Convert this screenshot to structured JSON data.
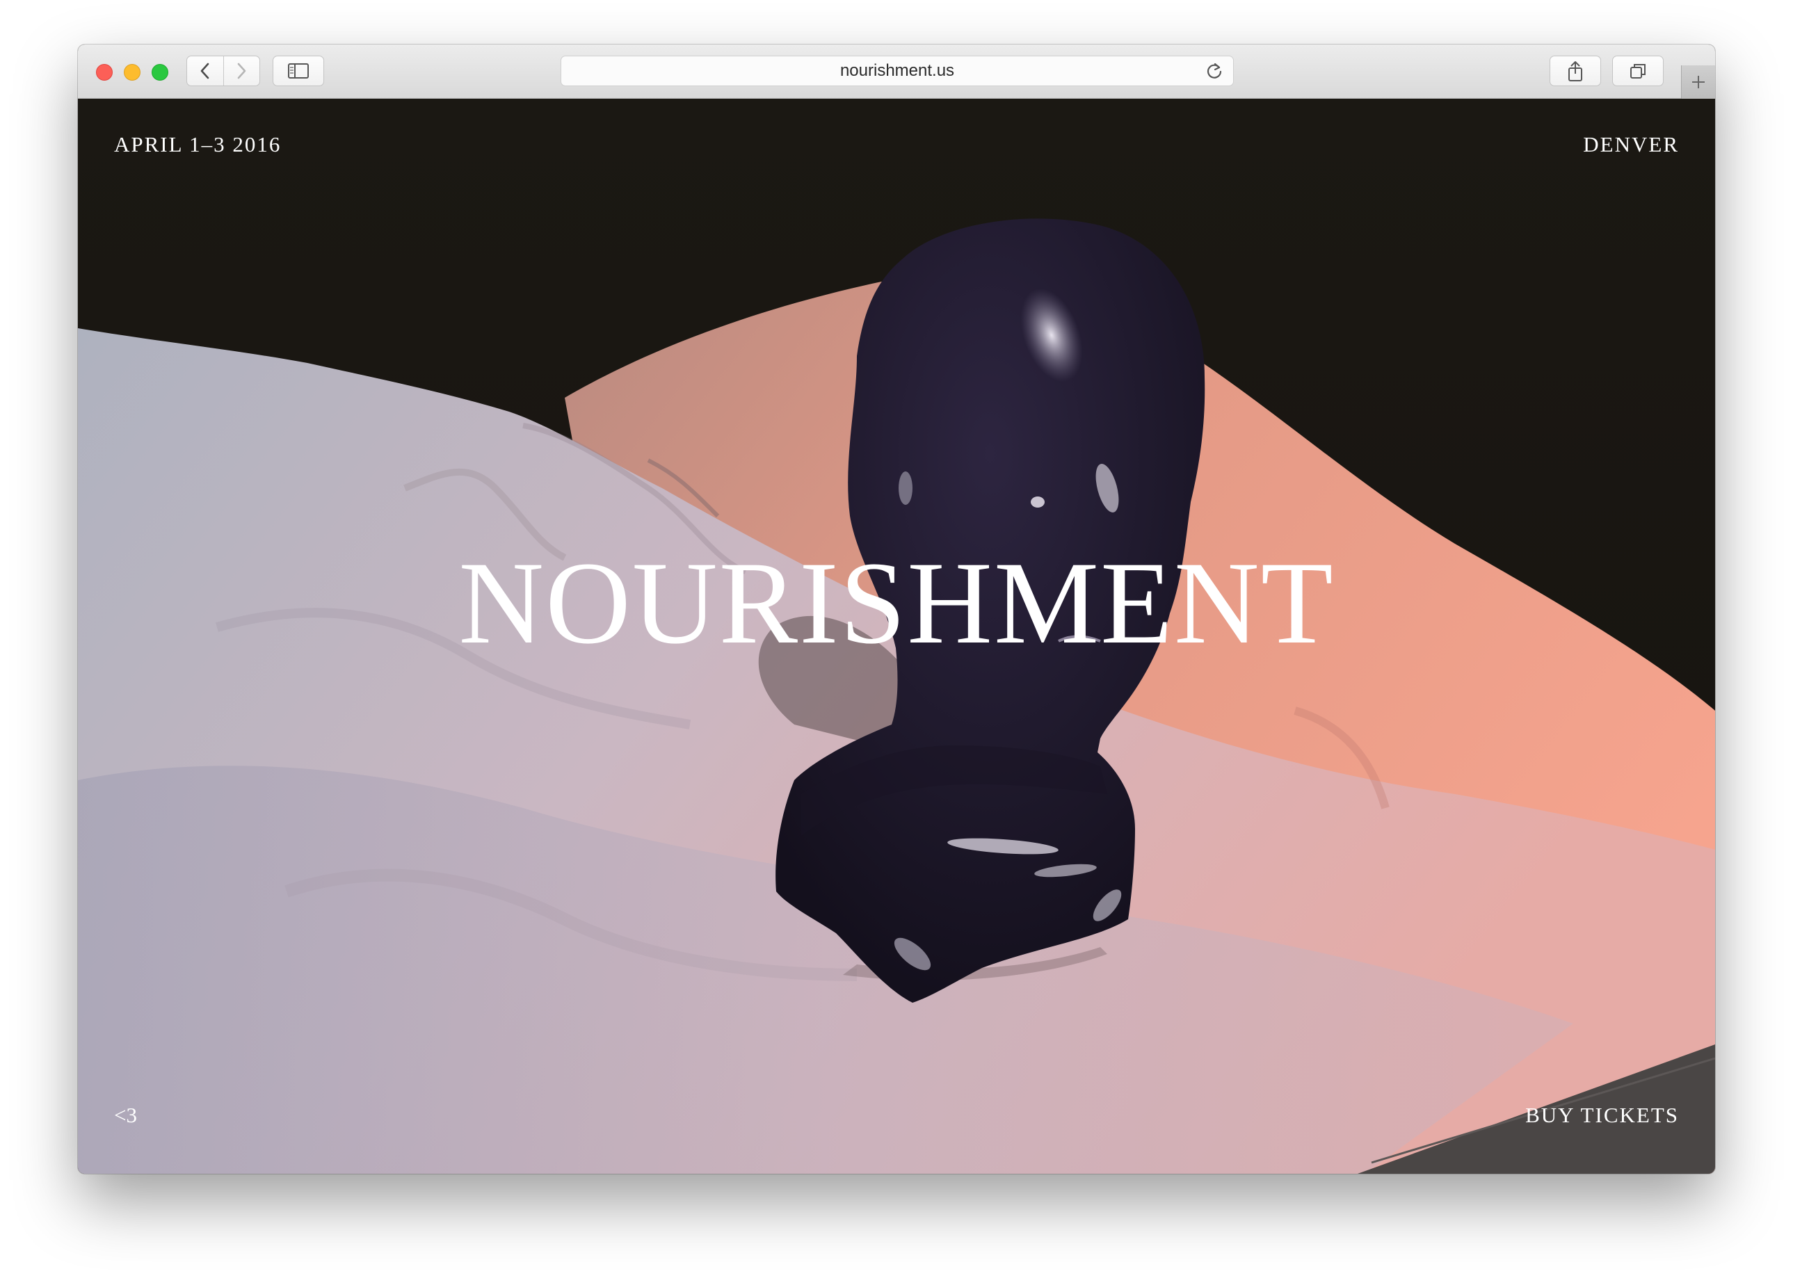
{
  "browser": {
    "url": "nourishment.us",
    "buttons": {
      "back": "chevron-left-icon",
      "forward": "chevron-right-icon",
      "sidebar": "sidebar-icon",
      "reload": "reload-icon",
      "share": "share-icon",
      "tabs": "tabs-icon",
      "new_tab": "plus-icon"
    }
  },
  "site": {
    "date": "APRIL 1–3 2016",
    "city": "DENVER",
    "title": "NOURISHMENT",
    "footer_left": "<3",
    "cta": "BUY TICKETS"
  },
  "colors": {
    "background": "#1b1814",
    "text": "#ffffff",
    "fabric_left": "#b9b6c2",
    "fabric_right": "#f2a48e",
    "bust": "#221c30"
  }
}
